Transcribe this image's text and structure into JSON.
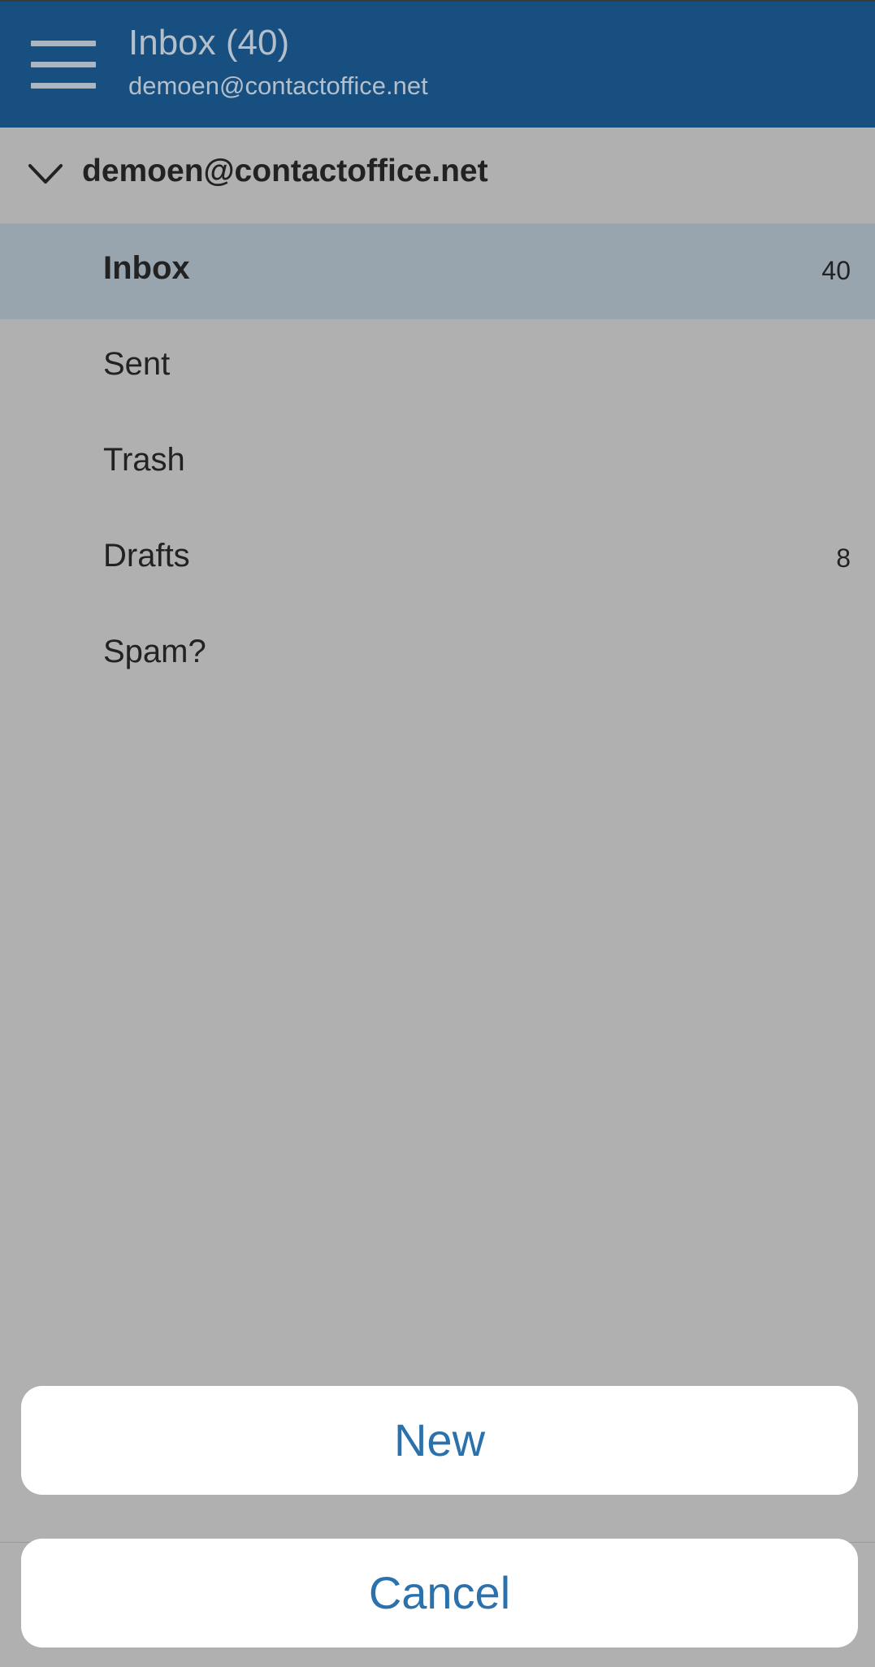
{
  "header": {
    "menu_icon": "hamburger-menu-icon",
    "title": "Inbox (40)",
    "subtitle": "demoen@contactoffice.net"
  },
  "account": {
    "expand_icon": "chevron-down-icon",
    "label": "demoen@contactoffice.net"
  },
  "folders": [
    {
      "label": "Inbox",
      "count": "40",
      "selected": true
    },
    {
      "label": "Sent",
      "count": ""
    },
    {
      "label": "Trash",
      "count": ""
    },
    {
      "label": "Drafts",
      "count": "8"
    },
    {
      "label": "Spam?",
      "count": ""
    }
  ],
  "action_sheet": {
    "new_label": "New",
    "cancel_label": "Cancel"
  },
  "colors": {
    "header_bg": "#174f80",
    "overlay_bg": "#b0b0b0",
    "selected_bg": "#98a4ae",
    "action_text": "#2b72ad"
  }
}
